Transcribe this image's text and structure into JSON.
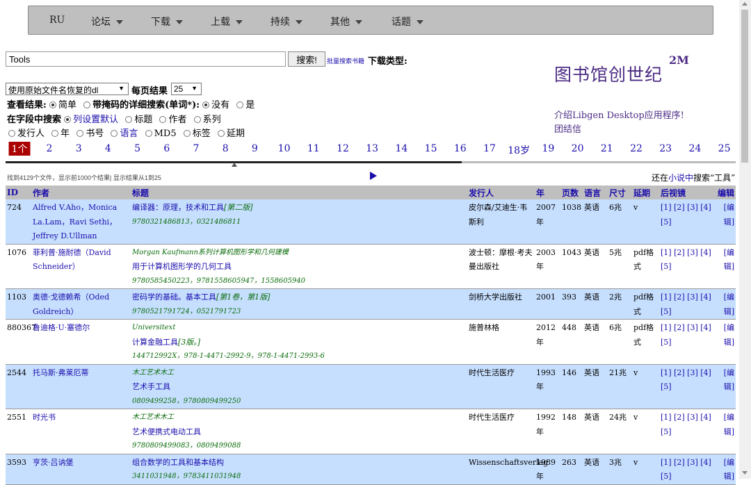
{
  "nav": {
    "items": [
      {
        "label": "RU",
        "dropdown": false
      },
      {
        "label": "论坛",
        "dropdown": true
      },
      {
        "label": "下载",
        "dropdown": true
      },
      {
        "label": "上载",
        "dropdown": true
      },
      {
        "label": "持续",
        "dropdown": true
      },
      {
        "label": "其他",
        "dropdown": true
      },
      {
        "label": "话题",
        "dropdown": true
      }
    ]
  },
  "search": {
    "value": "Tools",
    "button": "搜索!",
    "batch_link": "批量搜索书籍",
    "download_type": "下载类型:"
  },
  "logo": {
    "text": "图书馆创世纪",
    "sup": "2M",
    "intro_link": "介绍Libgen Desktop应用程序!",
    "group_link": "团结信"
  },
  "options": {
    "filename_select": "使用原始文件名恢复的dl",
    "per_page_label": "每页结果",
    "per_page_value": "25",
    "view_label": "查看结果:",
    "view_simple": "简单",
    "view_detailed": "带掩码的详细",
    "search_label": "搜索(单词*):",
    "none": "没有",
    "yes": "是",
    "field_label": "在字段中搜索",
    "fields": {
      "default": "列设置默认",
      "title": "标题",
      "author": "作者",
      "series": "系列",
      "publisher": "发行人",
      "year": "年",
      "isbn": "书号",
      "language": "语言",
      "md5": "MD5",
      "tags": "标签",
      "extension": "延期"
    }
  },
  "pagination": {
    "current": "1个",
    "pages": [
      "2",
      "3",
      "4",
      "5",
      "6",
      "7",
      "8",
      "9",
      "10",
      "11",
      "12",
      "13",
      "14",
      "15",
      "16",
      "17",
      "18岁",
      "19",
      "20",
      "21",
      "22",
      "23",
      "24",
      "25"
    ],
    "progress": 0.625
  },
  "results": {
    "found_text": "找到4129个文件，显示前1000个结果| 显示结果从1到25",
    "also_search_prefix": "还在",
    "also_search_link": "小说中",
    "also_search_suffix": "搜索“工具”"
  },
  "table": {
    "headers": [
      "ID",
      "作者",
      "标题",
      "发行人",
      "年",
      "页数",
      "语言",
      "尺寸",
      "延期",
      "后视镜",
      "编辑"
    ],
    "mirrors_text": "[1] [2] [3] [4] [5]",
    "edit_text": "[编辑]",
    "rows": [
      {
        "id": "724",
        "author": "Alfred V.Aho，Monica La.Lam，Ravi Sethi，Jeffrey D.Ullman",
        "series": "",
        "title": "编译器：原理，技术和工具",
        "edition": "[第二版]",
        "isbn": "9780321486813，0321486811",
        "publisher": "皮尔森/艾迪生·韦斯利",
        "year": "2007年",
        "pages": "1038",
        "lang": "英语",
        "size": "6兆",
        "ext": "v"
      },
      {
        "id": "1076",
        "author": "菲利普·施耐德（David Schneider）",
        "series": "Morgan Kaufmann系列计算机图形学和几何建模",
        "title": "用于计算机图形学的几何工具",
        "edition": "",
        "isbn": "9780585450223，9781558605947，1558605940",
        "publisher": "波士顿：摩根·考夫曼出版社",
        "year": "2003年",
        "pages": "1043",
        "lang": "英语",
        "size": "5兆",
        "ext": "pdf格式"
      },
      {
        "id": "1103",
        "author": "奥德·戈德赖希（Oded Goldreich）",
        "series": "",
        "title": "密码学的基础。基本工具",
        "edition": "[第1卷，第1版]",
        "isbn": "9780521791724，0521791723",
        "publisher": "剑桥大学出版社",
        "year": "2001",
        "pages": "393",
        "lang": "英语",
        "size": "2兆",
        "ext": "pdf格式"
      },
      {
        "id": "880367",
        "author": "鲁迪格·U·塞德尔",
        "series": "Universitext",
        "title": "计算金融工具",
        "edition": "[3版。]",
        "isbn": "144712992X，978-1-4471-2992-9，978-1-4471-2993-6",
        "publisher": "施普林格",
        "year": "2012年",
        "pages": "448",
        "lang": "英语",
        "size": "6兆",
        "ext": "pdf格式"
      },
      {
        "id": "2544",
        "author": "托马斯·弗莱厄蒂",
        "series": "木工艺术木工",
        "title": "艺术手工具",
        "edition": "",
        "isbn": "0809499258，9780809499250",
        "publisher": "时代生活医疗",
        "year": "1993年",
        "pages": "146",
        "lang": "英语",
        "size": "21兆",
        "ext": "v"
      },
      {
        "id": "2551",
        "author": "时光书",
        "series": "木工艺术木工",
        "title": "艺术便携式电动工具",
        "edition": "",
        "isbn": "9780809499083，0809499088",
        "publisher": "时代生活医疗",
        "year": "1992年",
        "pages": "148",
        "lang": "英语",
        "size": "24兆",
        "ext": "v"
      },
      {
        "id": "3593",
        "author": "亨茨·吕讷堡",
        "series": "",
        "title": "组合数学的工具和基本结构",
        "edition": "",
        "isbn": "3411031948，9783411031948",
        "publisher": "Wissenschaftsverlag",
        "year": "1989年",
        "pages": "263",
        "lang": "英语",
        "size": "3兆",
        "ext": "v"
      }
    ]
  }
}
